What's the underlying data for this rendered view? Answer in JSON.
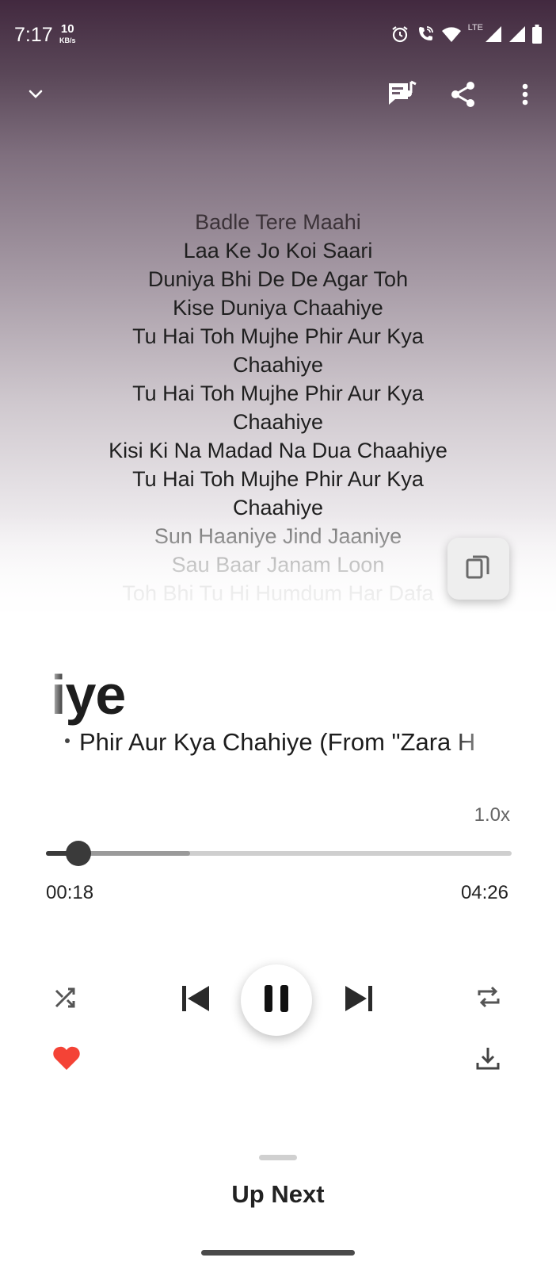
{
  "status_bar": {
    "time": "7:17",
    "net_speed_value": "10",
    "net_speed_unit": "KB/s",
    "network_label": "LTE"
  },
  "toolbar": {
    "collapse_icon": "chevron-down-icon",
    "lyrics_icon": "lyrics-icon",
    "share_icon": "share-icon",
    "more_icon": "more-vert-icon"
  },
  "lyrics": {
    "lines": [
      "Badle Tere Maahi",
      "Laa Ke Jo Koi Saari",
      "Duniya Bhi De De Agar Toh",
      "Kise Duniya Chaahiye",
      "Tu Hai Toh Mujhe Phir Aur Kya Chaahiye",
      "Tu Hai Toh Mujhe Phir Aur Kya Chaahiye",
      "Kisi Ki Na Madad Na Dua Chaahiye",
      "Tu Hai Toh Mujhe Phir Aur Kya Chaahiye",
      "Sun Haaniye Jind Jaaniye",
      "Sau Baar Janam Loon",
      "Toh Bhi Tu Hi Humdum Har Dafa"
    ]
  },
  "song": {
    "title_visible": "iye",
    "subtitle_visible": "Phir Aur Kya Chahiye (From \"Zara H"
  },
  "player": {
    "speed": "1.0x",
    "current_time": "00:18",
    "total_time": "04:26",
    "progress_fraction": 0.07,
    "buffered_fraction": 0.31,
    "liked": true,
    "like_color": "#f44336"
  },
  "up_next": {
    "label": "Up Next"
  }
}
